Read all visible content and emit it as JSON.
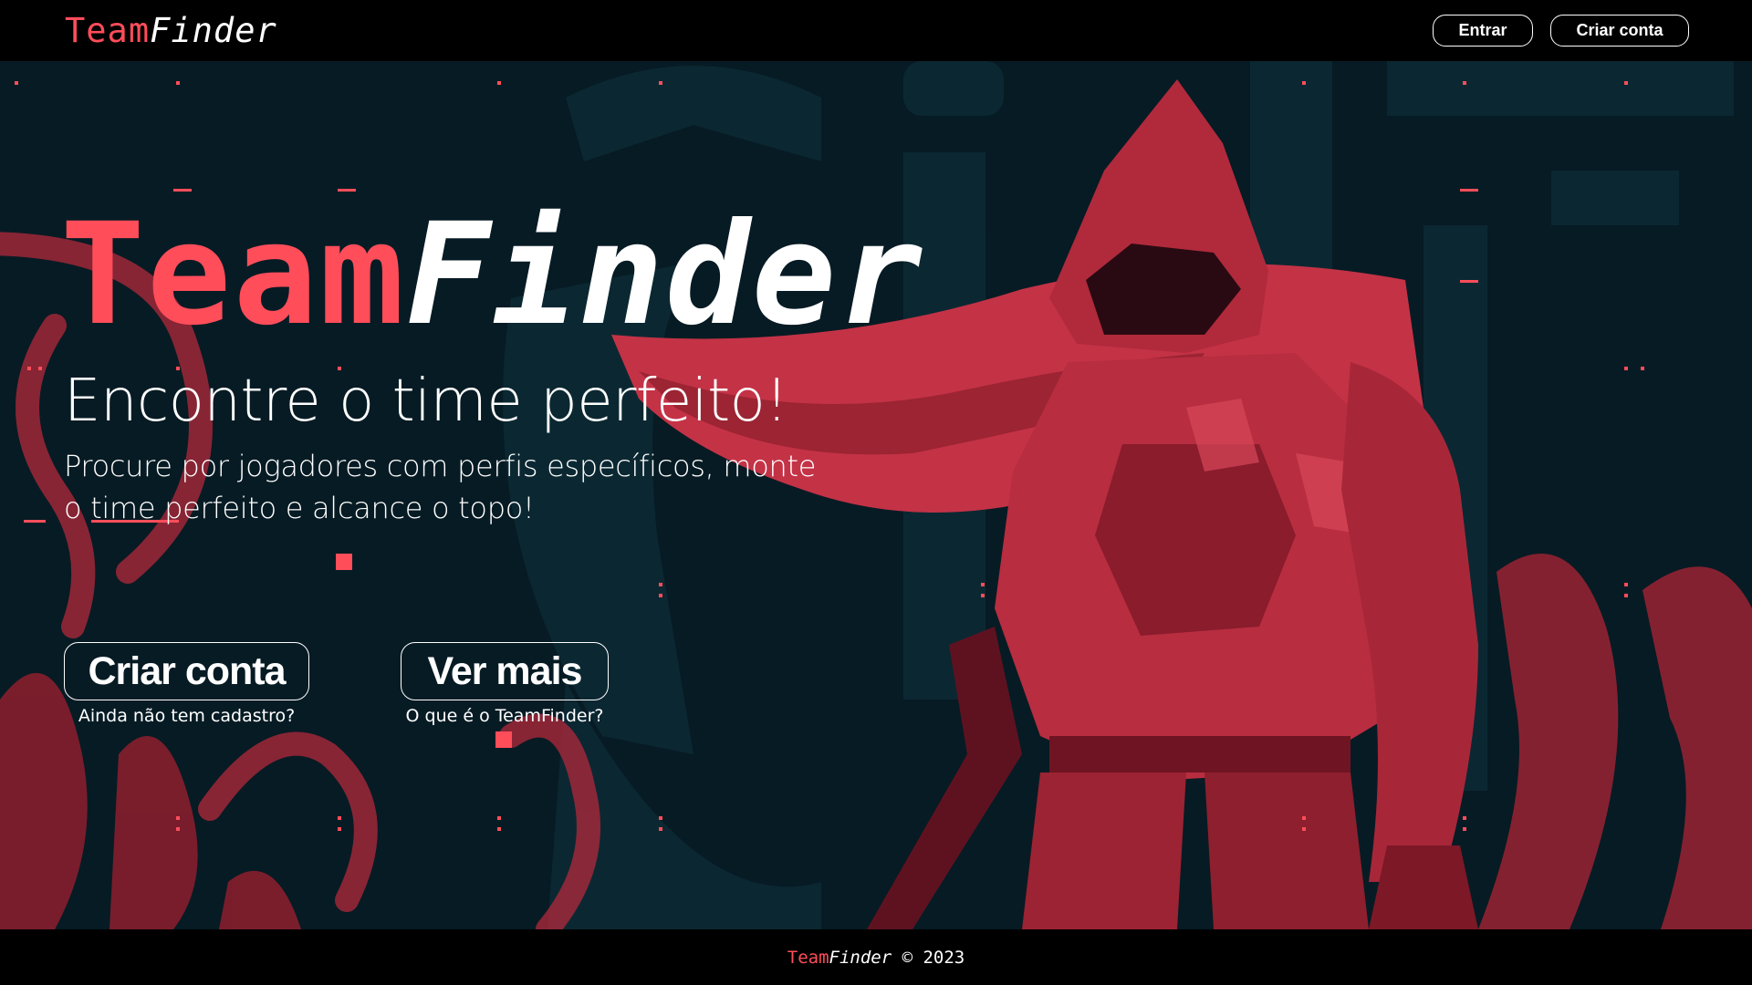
{
  "brand": {
    "name_part1": "Team",
    "name_part2": "Finder",
    "accent_color": "#ff4d5a",
    "text_color": "#ffffff",
    "background_color": "#071b24"
  },
  "header": {
    "login_label": "Entrar",
    "signup_label": "Criar conta"
  },
  "hero": {
    "title_part1": "Team",
    "title_part2": "Finder",
    "subtitle": "Encontre o time perfeito!",
    "description": "Procure por jogadores com perfis específicos, monte o time perfeito e alcance o topo!",
    "illustration_icon": "hooded-warrior-illustration",
    "primary_cta": {
      "label": "Criar conta",
      "hint": "Ainda não tem cadastro?"
    },
    "secondary_cta": {
      "label": "Ver mais",
      "hint": "O que é o TeamFinder?"
    }
  },
  "footer": {
    "brand_part1": "Team",
    "brand_part2": "Finder",
    "copyright": "© 2023"
  }
}
